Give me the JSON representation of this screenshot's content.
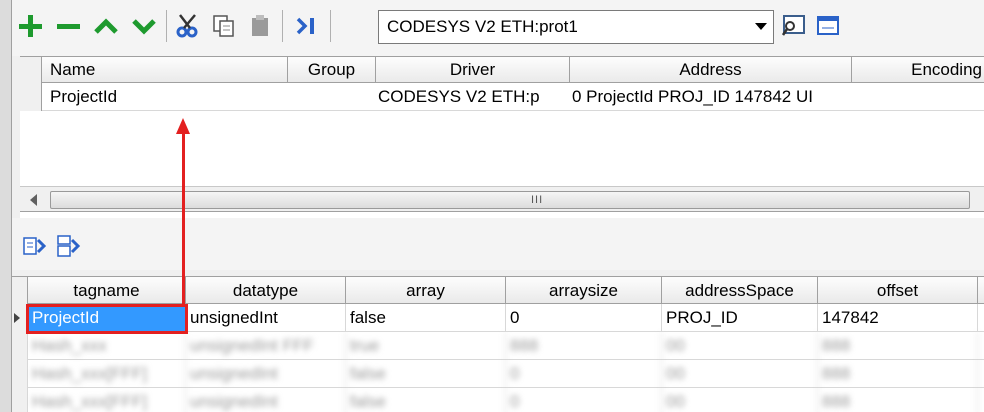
{
  "toolbar": {
    "driver_value": "CODESYS V2 ETH:prot1",
    "icons": [
      "add-icon",
      "remove-icon",
      "move-up-icon",
      "move-down-icon",
      "cut-icon",
      "copy-icon",
      "paste-icon",
      "goto-icon",
      "browse-icon",
      "window-icon"
    ],
    "colors": {
      "green": "#1e9a2e",
      "blue": "#2a62c8"
    }
  },
  "top_grid": {
    "columns": [
      "Name",
      "Group",
      "Driver",
      "Address",
      "Encoding"
    ],
    "rows": [
      {
        "name": "ProjectId",
        "group": "",
        "driver": "CODESYS V2 ETH:p",
        "address": "0 ProjectId PROJ_ID 147842 UI"
      }
    ],
    "scroll_grip": "III"
  },
  "bottom_grid": {
    "columns": [
      "tagname",
      "datatype",
      "array",
      "arraysize",
      "addressSpace",
      "offset"
    ],
    "rows": [
      {
        "tagname": "ProjectId",
        "datatype": "unsignedInt",
        "array": "false",
        "arraysize": "0",
        "addressSpace": "PROJ_ID",
        "offset": "147842"
      },
      {
        "tagname": "Hash_xxx",
        "datatype": "unsignedInt FFF",
        "array": "true",
        "arraysize": "888",
        "addressSpace": "00",
        "offset": "888"
      },
      {
        "tagname": "Hash_xxx[FFF]",
        "datatype": "unsignedInt",
        "array": "false",
        "arraysize": "0",
        "addressSpace": "00",
        "offset": "888"
      },
      {
        "tagname": "Hash_xxx[FFF]",
        "datatype": "unsignedInt",
        "array": "false",
        "arraysize": "0",
        "addressSpace": "00",
        "offset": "888"
      }
    ]
  },
  "annotation": {
    "color": "#e32020"
  }
}
